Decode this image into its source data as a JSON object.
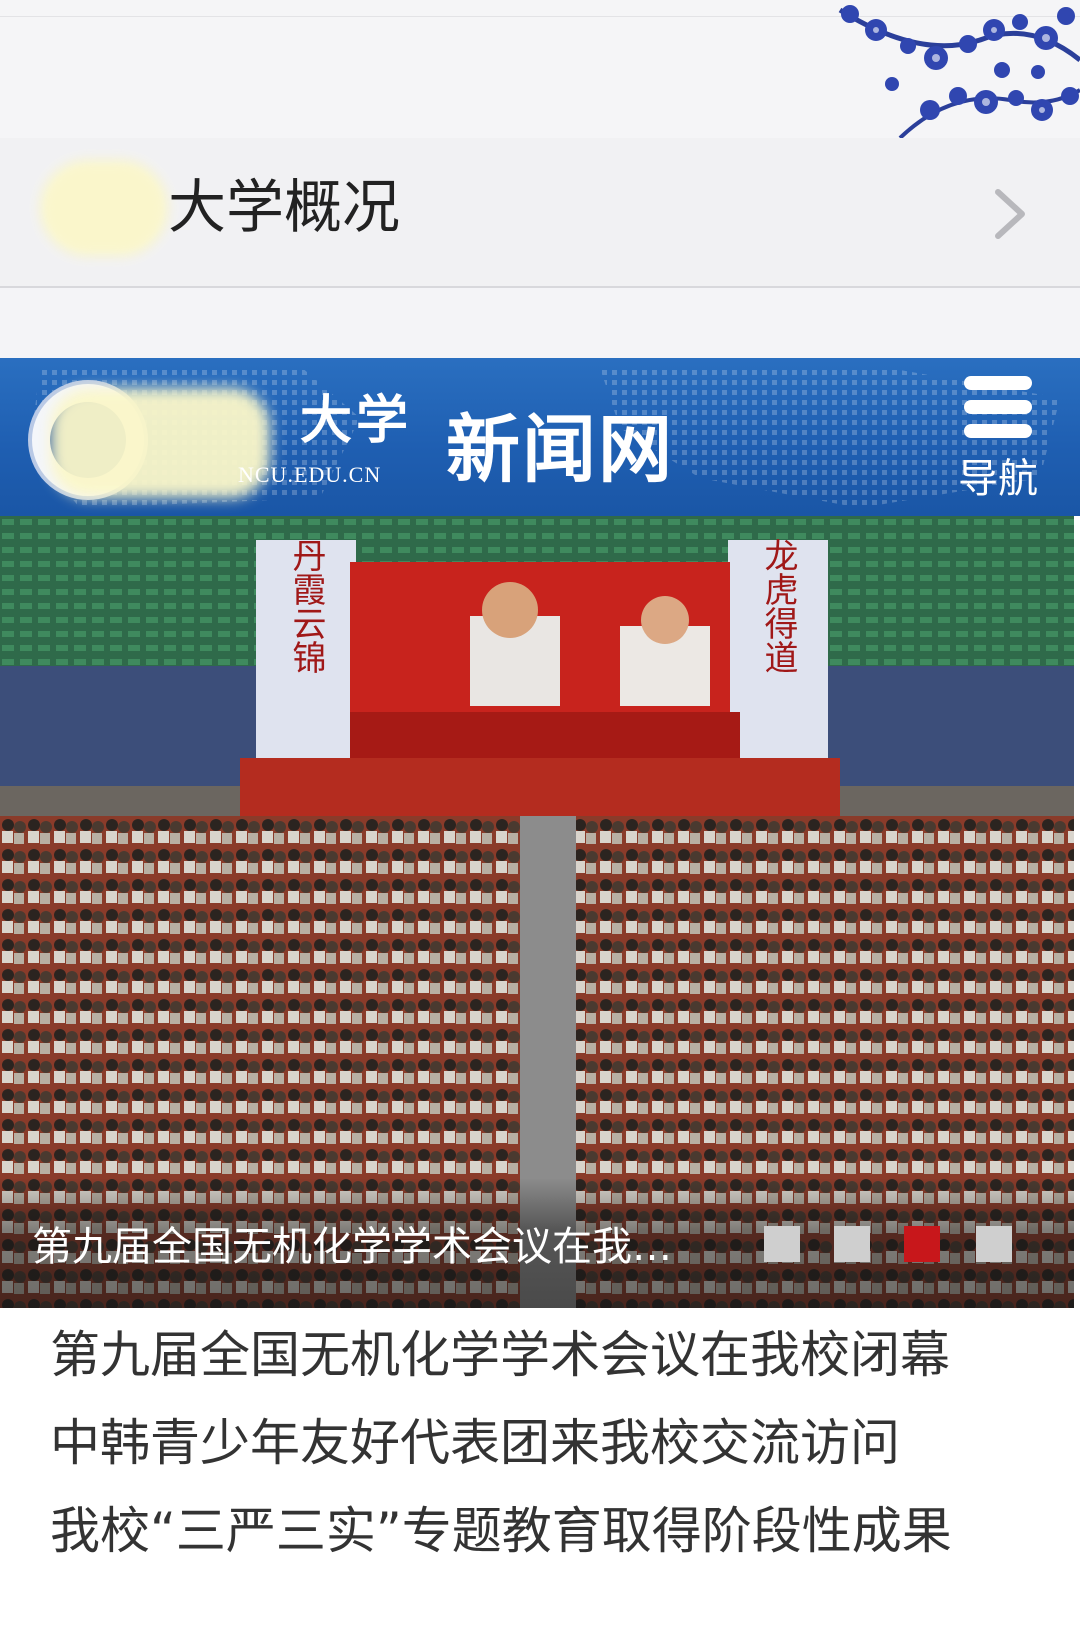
{
  "overview": {
    "label": "大学概况",
    "chevron_icon": "chevron-right-icon"
  },
  "header": {
    "brand_suffix": "大学",
    "domain": "NCU.EDU.CN",
    "site_name": "新闻网",
    "nav_label": "导航",
    "nav_icon": "menu-icon",
    "color": "#1f5fb2"
  },
  "slider": {
    "caption": "第九届全国无机化学学术会议在我…",
    "slide_count": 4,
    "active_index": 3,
    "active_color": "#c8171b",
    "banner_left": "丹霞云锦",
    "banner_right": "龙虎得道"
  },
  "news": [
    "第九届全国无机化学学术会议在我校闭幕",
    "中韩青少年友好代表团来我校交流访问",
    "我校“三严三实”专题教育取得阶段性成果"
  ]
}
